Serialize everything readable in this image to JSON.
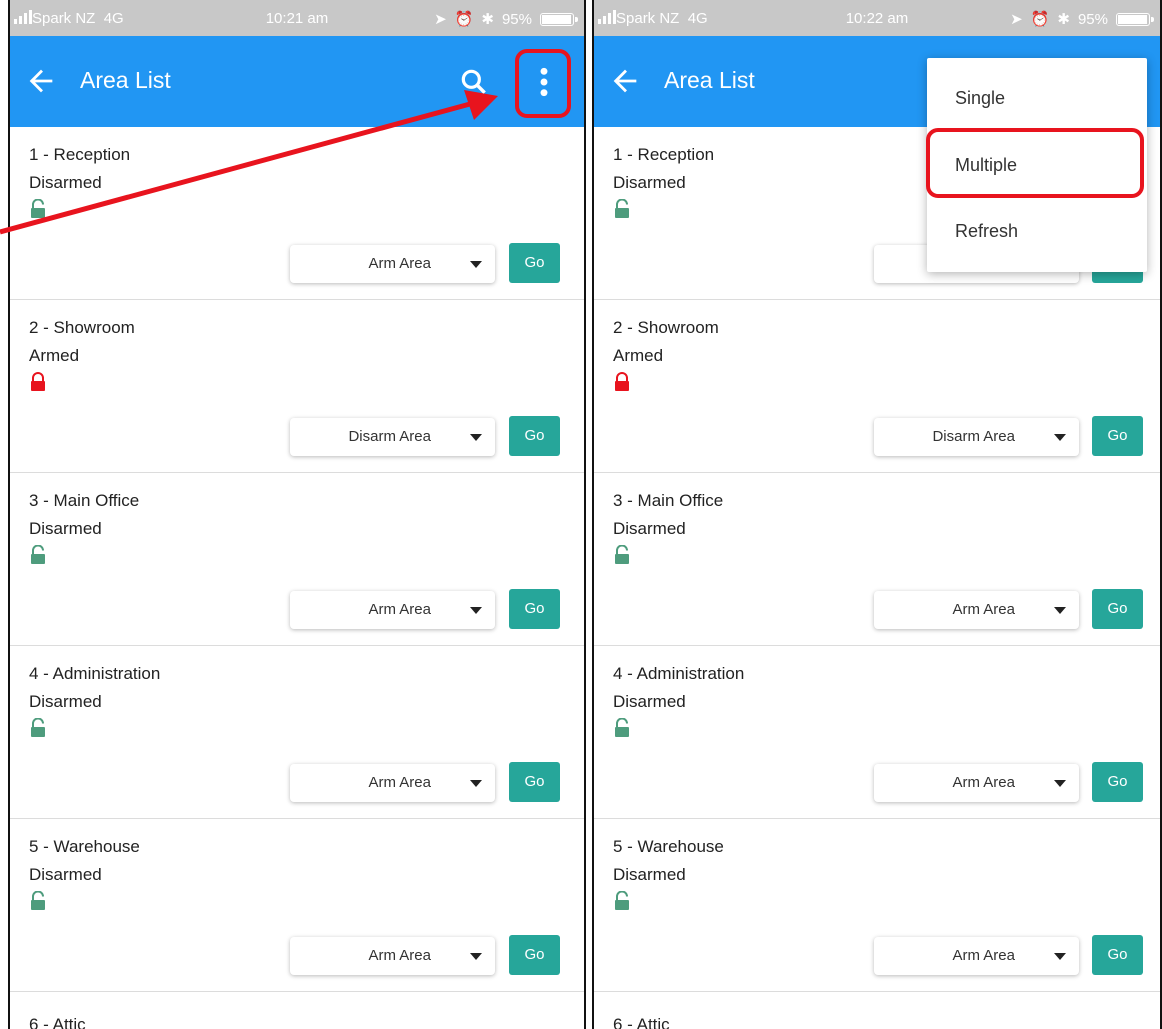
{
  "status_left": {
    "carrier": "Spark NZ",
    "network": "4G",
    "time": "10:21 am",
    "battery": "95%"
  },
  "status_right": {
    "carrier": "Spark NZ",
    "network": "4G",
    "time": "10:22 am",
    "battery": "95%"
  },
  "battery_level": 0.95,
  "appbar": {
    "title": "Area List",
    "back_icon": "arrow-left-icon",
    "search_icon": "search-icon",
    "more_icon": "more-vert-icon"
  },
  "areas": [
    {
      "name": "1 - Reception",
      "state": "Disarmed",
      "lock": "unlocked-icon",
      "action": "Arm Area",
      "go": "Go"
    },
    {
      "name": "2 - Showroom",
      "state": "Armed",
      "lock": "locked-icon",
      "action": "Disarm Area",
      "go": "Go"
    },
    {
      "name": "3 - Main Office",
      "state": "Disarmed",
      "lock": "unlocked-icon",
      "action": "Arm Area",
      "go": "Go"
    },
    {
      "name": "4 - Administration",
      "state": "Disarmed",
      "lock": "unlocked-icon",
      "action": "Arm Area",
      "go": "Go"
    },
    {
      "name": "5 - Warehouse",
      "state": "Disarmed",
      "lock": "unlocked-icon",
      "action": "Arm Area",
      "go": "Go"
    }
  ],
  "partial_area": "6 - Attic",
  "overflow_menu": [
    "Single",
    "Multiple",
    "Refresh"
  ],
  "colors": {
    "appbar": "#2196f3",
    "go_button": "#26a69a",
    "armed": "#e8141e",
    "disarmed": "#4e9c7d",
    "highlight": "#e8141e"
  }
}
